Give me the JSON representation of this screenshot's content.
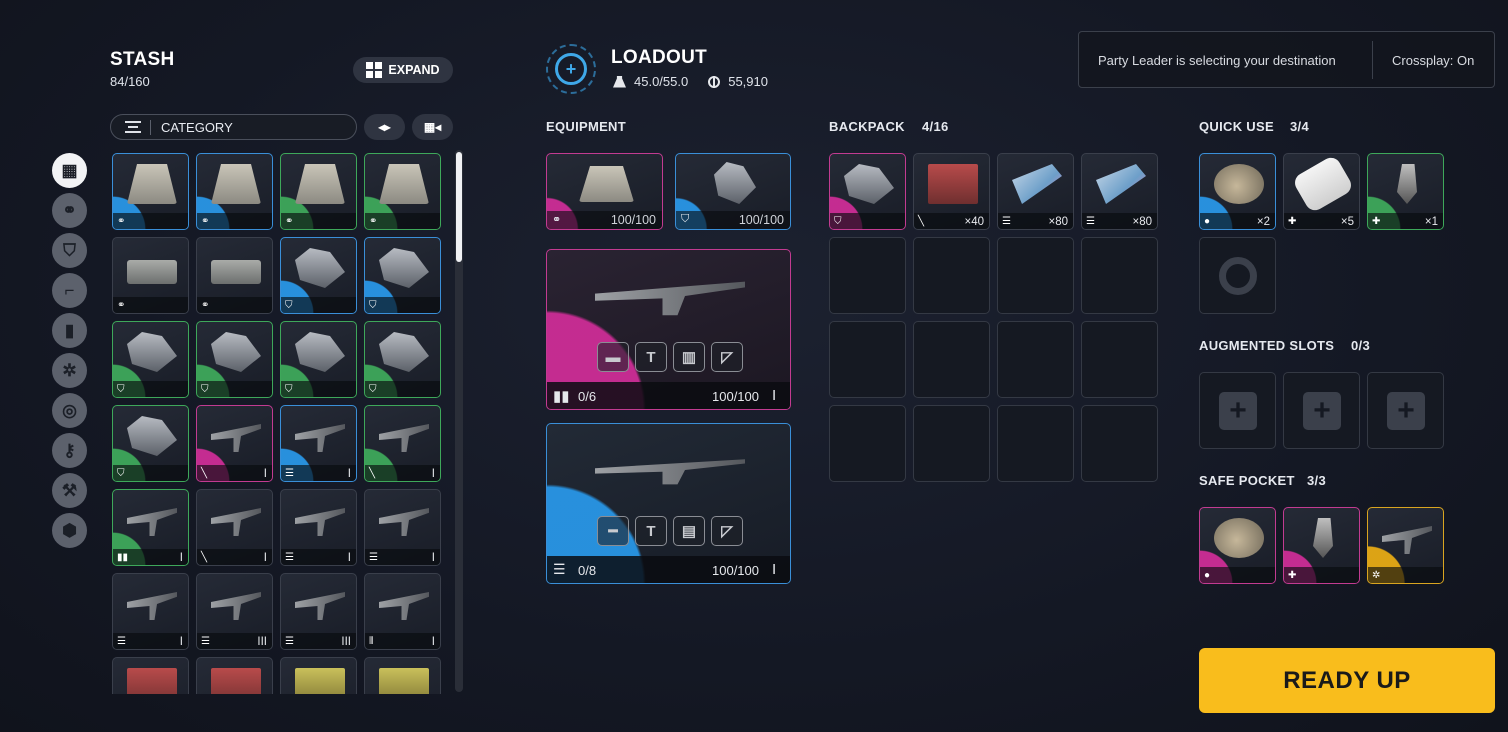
{
  "stash": {
    "title": "STASH",
    "count": "84/160",
    "expand_label": "EXPAND",
    "filter_label": "CATEGORY"
  },
  "loadout": {
    "title": "LOADOUT",
    "weight": "45.0/55.0",
    "coins": "55,910"
  },
  "status": {
    "message": "Party Leader is selecting your destination",
    "crossplay": "Crossplay: On"
  },
  "equipment": {
    "label": "EQUIPMENT",
    "augment_slot": {
      "durability": "100/100",
      "rarity": "pink",
      "icon": "augment-icon"
    },
    "shield_slot": {
      "durability": "100/100",
      "rarity": "blue",
      "icon": "shield-icon"
    },
    "weapon1": {
      "ammo": "0/6",
      "durability": "100/100",
      "tier": "I",
      "rarity": "pink"
    },
    "weapon2": {
      "ammo": "0/8",
      "durability": "100/100",
      "tier": "I",
      "rarity": "blue"
    }
  },
  "backpack": {
    "label": "BACKPACK",
    "count": "4/16",
    "items": [
      {
        "rarity": "pink",
        "icon": "shield-icon",
        "qty": ""
      },
      {
        "rarity": "none",
        "icon": "ammo-light-icon",
        "qty": "×40"
      },
      {
        "rarity": "none",
        "icon": "ammo-medium-icon",
        "qty": "×80"
      },
      {
        "rarity": "none",
        "icon": "ammo-medium-icon",
        "qty": "×80"
      }
    ]
  },
  "quick_use": {
    "label": "QUICK USE",
    "count": "3/4",
    "items": [
      {
        "rarity": "blue",
        "icon": "grenade-icon",
        "qty": "×2"
      },
      {
        "rarity": "none",
        "icon": "medkit-icon",
        "qty": "×5"
      },
      {
        "rarity": "green",
        "icon": "medkit-icon",
        "qty": "×1"
      }
    ]
  },
  "augmented": {
    "label": "AUGMENTED SLOTS",
    "count": "0/3"
  },
  "safe_pocket": {
    "label": "SAFE POCKET",
    "count": "3/3",
    "items": [
      {
        "rarity": "pink",
        "icon": "grenade-icon"
      },
      {
        "rarity": "pink",
        "icon": "medkit-icon"
      },
      {
        "rarity": "gold",
        "icon": "gear-icon"
      }
    ]
  },
  "ready_label": "READY UP",
  "stash_items": [
    {
      "rarity": "blue",
      "art": "case",
      "icon": "augment-icon",
      "tier": ""
    },
    {
      "rarity": "blue",
      "art": "case",
      "icon": "augment-icon",
      "tier": ""
    },
    {
      "rarity": "green",
      "art": "case",
      "icon": "augment-icon",
      "tier": ""
    },
    {
      "rarity": "green",
      "art": "case",
      "icon": "augment-icon",
      "tier": ""
    },
    {
      "rarity": "none",
      "art": "box",
      "icon": "augment-icon",
      "tier": ""
    },
    {
      "rarity": "none",
      "art": "box",
      "icon": "augment-icon",
      "tier": ""
    },
    {
      "rarity": "blue",
      "art": "pack",
      "icon": "shield-icon",
      "tier": ""
    },
    {
      "rarity": "blue",
      "art": "pack",
      "icon": "shield-icon",
      "tier": ""
    },
    {
      "rarity": "green",
      "art": "pack",
      "icon": "shield-icon",
      "tier": ""
    },
    {
      "rarity": "green",
      "art": "pack",
      "icon": "shield-icon",
      "tier": ""
    },
    {
      "rarity": "green",
      "art": "pack",
      "icon": "shield-icon",
      "tier": ""
    },
    {
      "rarity": "green",
      "art": "pack",
      "icon": "shield-icon",
      "tier": ""
    },
    {
      "rarity": "green",
      "art": "pack",
      "icon": "shield-icon",
      "tier": ""
    },
    {
      "rarity": "pink",
      "art": "gun",
      "icon": "ammo-light-icon",
      "tier": "I"
    },
    {
      "rarity": "blue",
      "art": "gun",
      "icon": "ammo-medium-icon",
      "tier": "I"
    },
    {
      "rarity": "green",
      "art": "gun",
      "icon": "ammo-light-icon",
      "tier": "I"
    },
    {
      "rarity": "green",
      "art": "gun",
      "icon": "ammo-heavy-icon",
      "tier": "I"
    },
    {
      "rarity": "none",
      "art": "gun",
      "icon": "ammo-light-icon",
      "tier": "I"
    },
    {
      "rarity": "none",
      "art": "gun",
      "icon": "ammo-medium-icon",
      "tier": "I"
    },
    {
      "rarity": "none",
      "art": "gun",
      "icon": "ammo-medium-icon",
      "tier": "I"
    },
    {
      "rarity": "none",
      "art": "gun",
      "icon": "ammo-medium-icon",
      "tier": "I"
    },
    {
      "rarity": "none",
      "art": "gun",
      "icon": "ammo-medium-icon",
      "tier": "III"
    },
    {
      "rarity": "none",
      "art": "gun",
      "icon": "ammo-medium-icon",
      "tier": "III"
    },
    {
      "rarity": "none",
      "art": "gun",
      "icon": "ammo-energy-icon",
      "tier": "I"
    },
    {
      "rarity": "none",
      "art": "crate",
      "icon": "",
      "tier": ""
    },
    {
      "rarity": "none",
      "art": "crate",
      "icon": "",
      "tier": ""
    },
    {
      "rarity": "none",
      "art": "crate2",
      "icon": "",
      "tier": ""
    },
    {
      "rarity": "none",
      "art": "crate2",
      "icon": "",
      "tier": ""
    }
  ],
  "categories": [
    "grid-icon",
    "augment-icon",
    "shield-icon",
    "weapon-icon",
    "ammo-icon",
    "gear-icon",
    "trinket-icon",
    "key-icon",
    "wrench-icon",
    "cube-icon"
  ]
}
